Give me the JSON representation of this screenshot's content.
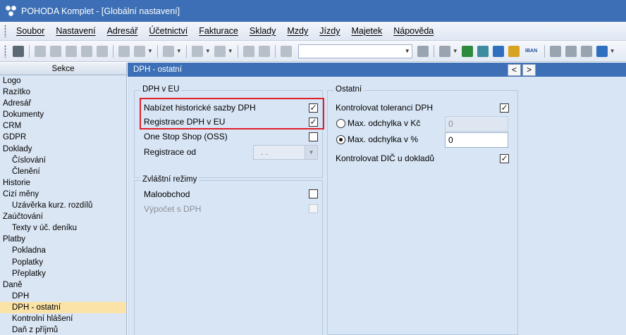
{
  "window": {
    "title": "POHODA Komplet - [Globální nastavení]"
  },
  "menu": [
    "Soubor",
    "Nastavení",
    "Adresář",
    "Účetnictví",
    "Fakturace",
    "Sklady",
    "Mzdy",
    "Jízdy",
    "Majetek",
    "Nápověda"
  ],
  "toolbar": {
    "search_value": "",
    "iban_label": "IBAN"
  },
  "left_panel": {
    "header": "Sekce",
    "items": [
      {
        "label": "Logo",
        "level": 0
      },
      {
        "label": "Razítko",
        "level": 0
      },
      {
        "label": "Adresář",
        "level": 0
      },
      {
        "label": "Dokumenty",
        "level": 0
      },
      {
        "label": "CRM",
        "level": 0
      },
      {
        "label": "GDPR",
        "level": 0
      },
      {
        "label": "Doklady",
        "level": 0
      },
      {
        "label": "Číslování",
        "level": 1
      },
      {
        "label": "Členění",
        "level": 1
      },
      {
        "label": "Historie",
        "level": 0
      },
      {
        "label": "Cizí měny",
        "level": 0
      },
      {
        "label": "Uzávěrka kurz. rozdílů",
        "level": 1
      },
      {
        "label": "Zaúčtování",
        "level": 0
      },
      {
        "label": "Texty v úč. deníku",
        "level": 1
      },
      {
        "label": "Platby",
        "level": 0
      },
      {
        "label": "Pokladna",
        "level": 1
      },
      {
        "label": "Poplatky",
        "level": 1
      },
      {
        "label": "Přeplatky",
        "level": 1
      },
      {
        "label": "Daně",
        "level": 0
      },
      {
        "label": "DPH",
        "level": 1
      },
      {
        "label": "DPH - ostatní",
        "level": 1,
        "selected": true
      },
      {
        "label": "Kontrolní hlášení",
        "level": 1
      },
      {
        "label": "Daň z příjmů",
        "level": 1
      }
    ]
  },
  "content": {
    "header": "DPH - ostatní",
    "nav_prev": "<",
    "nav_next": ">",
    "dph_eu": {
      "title": "DPH v EU",
      "historic_rates_label": "Nabízet historické sazby DPH",
      "historic_rates_checked": true,
      "registration_eu_label": "Registrace DPH v EU",
      "registration_eu_checked": true,
      "oss_label": "One Stop Shop (OSS)",
      "oss_checked": false,
      "registration_from_label": "Registrace od",
      "registration_from_value": ". ."
    },
    "special": {
      "title": "Zvláštní režimy",
      "retail_label": "Maloobchod",
      "retail_checked": false,
      "calc_label": "Výpočet s DPH",
      "calc_checked": false
    },
    "other": {
      "title": "Ostatní",
      "tolerance_label": "Kontrolovat toleranci DPH",
      "tolerance_checked": true,
      "max_kc_label": "Max. odchylka v Kč",
      "max_kc_value": "0",
      "max_pct_label": "Max. odchylka v %",
      "max_pct_value": "0",
      "selected_option": "pct",
      "dic_label": "Kontrolovat DIČ u dokladů",
      "dic_checked": true
    }
  },
  "colors": {
    "accent": "#3c6fb5",
    "highlight": "#e0202a",
    "selection": "#fbe3a7"
  }
}
